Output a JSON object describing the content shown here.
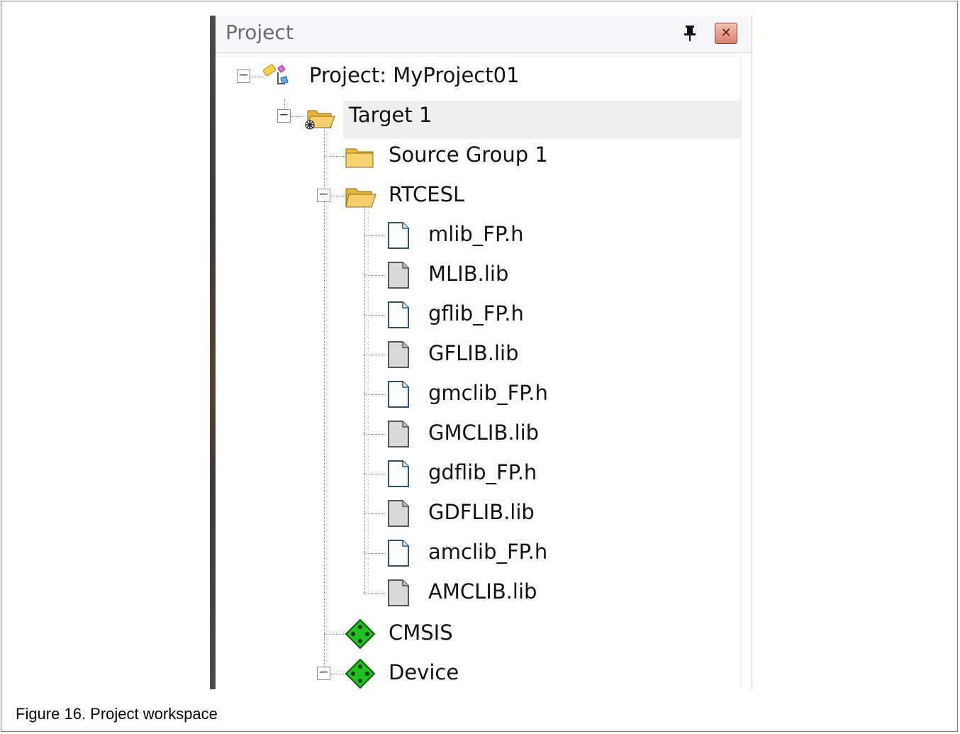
{
  "panel": {
    "title": "Project",
    "pin_glyph": "Ⅲ",
    "close_glyph": "✕"
  },
  "tree": {
    "project": {
      "label": "Project: MyProject01",
      "icon": "project-icon",
      "expanded": true
    },
    "target": {
      "label": "Target 1",
      "icon": "open-folder-icon",
      "expanded": true,
      "selected": true
    },
    "groups": [
      {
        "label": "Source Group 1",
        "icon": "folder-icon"
      },
      {
        "label": "RTCESL",
        "icon": "open-folder-icon",
        "expanded": true
      }
    ],
    "files": [
      {
        "label": "mlib_FP.h",
        "type": "header"
      },
      {
        "label": "MLIB.lib",
        "type": "library"
      },
      {
        "label": "gflib_FP.h",
        "type": "header"
      },
      {
        "label": "GFLIB.lib",
        "type": "library"
      },
      {
        "label": "gmclib_FP.h",
        "type": "header"
      },
      {
        "label": "GMCLIB.lib",
        "type": "library"
      },
      {
        "label": "gdflib_FP.h",
        "type": "header"
      },
      {
        "label": "GDFLIB.lib",
        "type": "library"
      },
      {
        "label": "amclib_FP.h",
        "type": "header"
      },
      {
        "label": "AMCLIB.lib",
        "type": "library"
      }
    ],
    "components": [
      {
        "label": "CMSIS",
        "icon": "green-diamond-icon"
      },
      {
        "label": "Device",
        "icon": "green-diamond-icon",
        "expanded": true
      }
    ]
  },
  "caption": "Figure 16.  Project workspace",
  "colors": {
    "selection": "#efefef",
    "folder": "#f0c24a",
    "component": "#1fb21f"
  }
}
